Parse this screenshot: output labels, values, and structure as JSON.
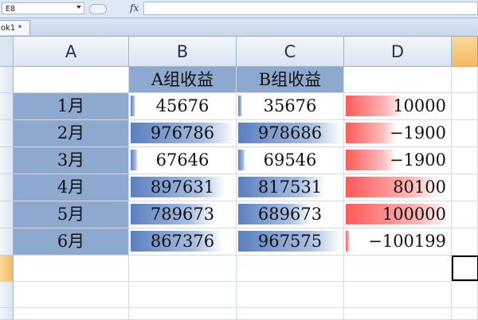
{
  "formula_bar": {
    "name_box": "E8",
    "fx": "fx",
    "formula": ""
  },
  "workbook_tab": {
    "label": "ok1 *"
  },
  "columns": [
    "A",
    "B",
    "C",
    "D"
  ],
  "header_row": {
    "a": "",
    "b": "A组收益",
    "c": "B组收益",
    "d": ""
  },
  "rows": [
    {
      "month": "1月",
      "a_income": "45676",
      "b_income": "35676",
      "d_value": "10000"
    },
    {
      "month": "2月",
      "a_income": "976786",
      "b_income": "978686",
      "d_value": "−1900"
    },
    {
      "month": "3月",
      "a_income": "67646",
      "b_income": "69546",
      "d_value": "−1900"
    },
    {
      "month": "4月",
      "a_income": "897631",
      "b_income": "817531",
      "d_value": "80100"
    },
    {
      "month": "5月",
      "a_income": "789673",
      "b_income": "689673",
      "d_value": "100000"
    },
    {
      "month": "6月",
      "a_income": "867376",
      "b_income": "967575",
      "d_value": "−100199"
    }
  ],
  "data_bars": {
    "b_max": 976786,
    "c_max": 978686,
    "d_min": -100199,
    "d_max": 100000,
    "b_values": [
      45676,
      976786,
      67646,
      897631,
      789673,
      867376
    ],
    "c_values": [
      35676,
      978686,
      69546,
      817531,
      689673,
      967575
    ],
    "d_values": [
      10000,
      -1900,
      -1900,
      80100,
      100000,
      -100199
    ],
    "blue_color": "#5b7fc0",
    "red_color": "#ff5a5a",
    "label_fill_color": "#8ea9cf"
  },
  "selected_cell": "E8"
}
